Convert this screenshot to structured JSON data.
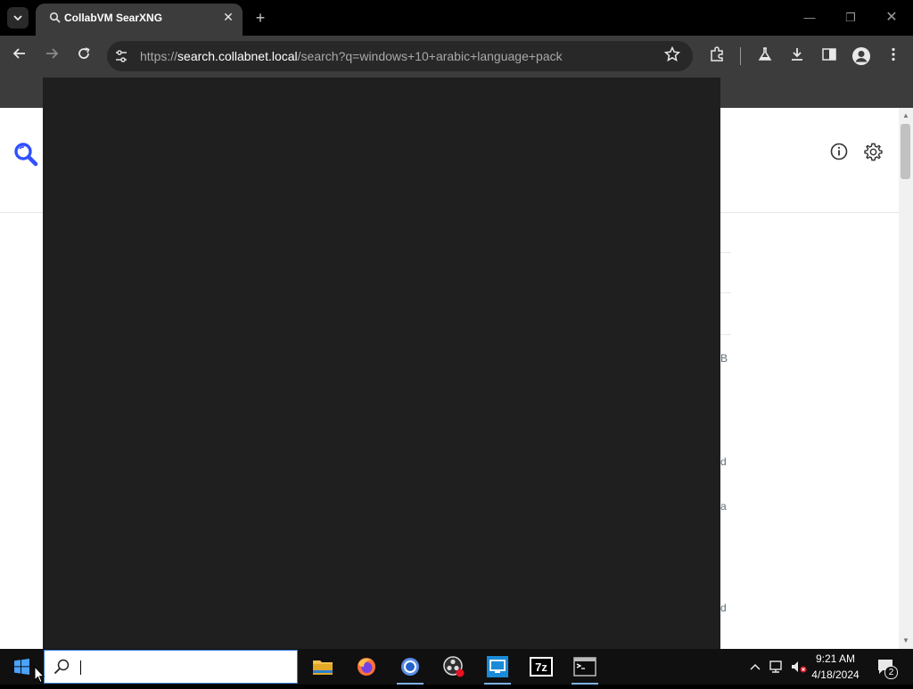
{
  "browser": {
    "tab_title": "CollabVM SearXNG",
    "new_tab_label": "+",
    "url_scheme": "https://",
    "url_host": "search.collabnet.local",
    "url_path": "/search?q=windows+10+arabic+language+pack"
  },
  "page": {
    "fragments": [
      "B",
      "d",
      "a",
      "d"
    ]
  },
  "taskbar": {
    "search_value": "",
    "apps": [
      "file-explorer",
      "firefox",
      "chrome",
      "obs-studio",
      "remote-desktop",
      "7-zip",
      "command-prompt"
    ],
    "notification_count": "2",
    "clock_time": "9:21 AM",
    "clock_date": "4/18/2024"
  },
  "colors": {
    "accent": "#3b7ed9",
    "start_menu_bg": "#1f1f1f",
    "chrome_toolbar": "#3c3c3c",
    "searx_blue": "#3050ff"
  }
}
